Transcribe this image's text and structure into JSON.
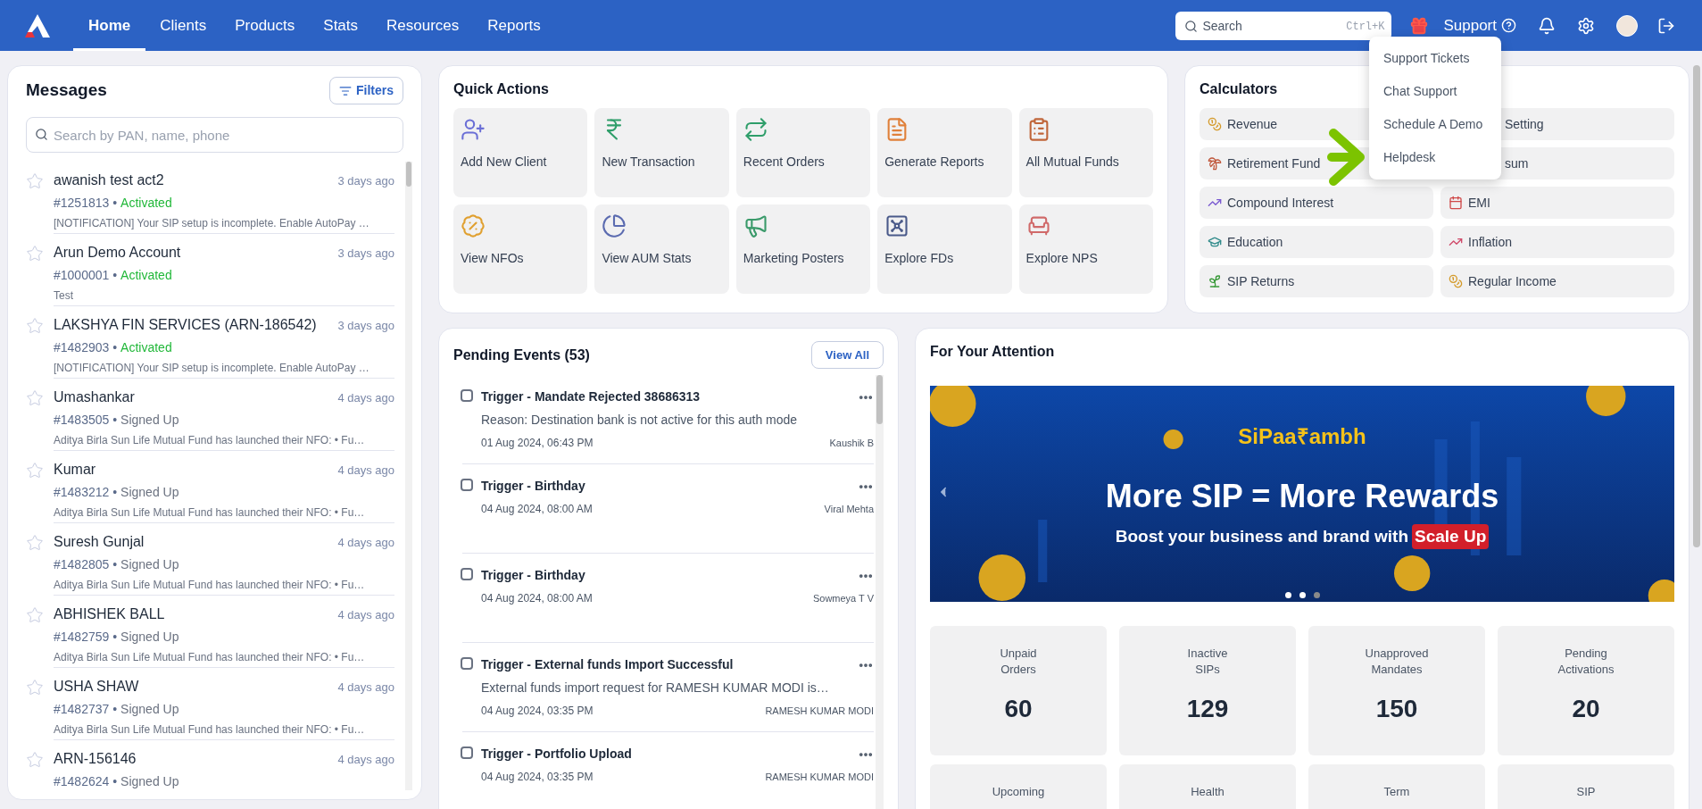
{
  "nav": {
    "tabs": [
      {
        "label": "Home",
        "selected": true
      },
      {
        "label": "Clients",
        "selected": false
      },
      {
        "label": "Products",
        "selected": false
      },
      {
        "label": "Stats",
        "selected": false
      },
      {
        "label": "Resources",
        "selected": false
      },
      {
        "label": "Reports",
        "selected": false
      }
    ],
    "search": {
      "placeholder": "Search",
      "shortcut": "Ctrl+K"
    },
    "support": "Support"
  },
  "support_menu": [
    "Support Tickets",
    "Chat Support",
    "Schedule A Demo",
    "Helpdesk"
  ],
  "messages": {
    "title": "Messages",
    "filters": "Filters",
    "search_placeholder": "Search by PAN, name, phone",
    "items": [
      {
        "name": "awanish test act2",
        "time": "3 days ago",
        "id": "#1251813 •",
        "status": "Activated",
        "kind": "activated",
        "starred": false,
        "preview": "[NOTIFICATION] Your SIP setup is incomplete. Enable AutoPay …"
      },
      {
        "name": "Arun Demo Account",
        "time": "3 days ago",
        "id": "#1000001 •",
        "status": "Activated",
        "kind": "activated",
        "starred": false,
        "preview": "Test"
      },
      {
        "name": "LAKSHYA FIN SERVICES (ARN-186542)",
        "time": "3 days ago",
        "id": "#1482903 •",
        "status": "Activated",
        "kind": "activated",
        "starred": false,
        "preview": "[NOTIFICATION] Your SIP setup is incomplete. Enable AutoPay …"
      },
      {
        "name": "Umashankar",
        "time": "4 days ago",
        "id": "#1483505 •",
        "status": "Signed Up",
        "kind": "signed",
        "starred": false,
        "preview": "Aditya Birla Sun Life Mutual Fund has launched their NFO: • Fu…"
      },
      {
        "name": "Kumar",
        "time": "4 days ago",
        "id": "#1483212 •",
        "status": "Signed Up",
        "kind": "signed",
        "starred": false,
        "preview": "Aditya Birla Sun Life Mutual Fund has launched their NFO: • Fu…"
      },
      {
        "name": "Suresh Gunjal",
        "time": "4 days ago",
        "id": "#1482805 •",
        "status": "Signed Up",
        "kind": "signed",
        "starred": false,
        "preview": "Aditya Birla Sun Life Mutual Fund has launched their NFO: • Fu…"
      },
      {
        "name": "ABHISHEK BALL",
        "time": "4 days ago",
        "id": "#1482759 •",
        "status": "Signed Up",
        "kind": "signed",
        "starred": false,
        "preview": "Aditya Birla Sun Life Mutual Fund has launched their NFO: • Fu…"
      },
      {
        "name": "USHA SHAW",
        "time": "4 days ago",
        "id": "#1482737 •",
        "status": "Signed Up",
        "kind": "signed",
        "starred": false,
        "preview": "Aditya Birla Sun Life Mutual Fund has launched their NFO: • Fu…"
      },
      {
        "name": "ARN-156146",
        "time": "4 days ago",
        "id": "#1482624 •",
        "status": "Signed Up",
        "kind": "signed",
        "starred": false
      }
    ]
  },
  "quick_actions": {
    "title": "Quick Actions",
    "items": [
      "Add New Client",
      "New Transaction",
      "Recent Orders",
      "Generate Reports",
      "All Mutual Funds",
      "View NFOs",
      "View AUM Stats",
      "Marketing Posters",
      "Explore FDs",
      "Explore NPS"
    ]
  },
  "calculators": {
    "title": "Calculators",
    "items": [
      {
        "label": "Revenue",
        "kind": "full"
      },
      {
        "label": "Setting",
        "kind": "covered"
      },
      {
        "label": "Retirement Fund",
        "kind": "full"
      },
      {
        "label": "sum",
        "kind": "covered"
      },
      {
        "label": "Compound Interest",
        "kind": "full"
      },
      {
        "label": "EMI",
        "kind": "full"
      },
      {
        "label": "Education",
        "kind": "full"
      },
      {
        "label": "Inflation",
        "kind": "full"
      },
      {
        "label": "SIP Returns",
        "kind": "full"
      },
      {
        "label": "Regular Income",
        "kind": "full"
      }
    ]
  },
  "pending_events": {
    "title": "Pending Events (53)",
    "view_all": "View All",
    "events": [
      {
        "title": "Trigger - Mandate Rejected 38686313",
        "detail": "Reason: Destination bank is not active for this auth mode",
        "time": "01 Aug 2024, 06:43 PM",
        "person": "Kaushik B",
        "checked": false
      },
      {
        "title": "Trigger - Birthday",
        "time": "04 Aug 2024, 08:00 AM",
        "person": "Viral Mehta",
        "checked": false
      },
      {
        "title": "Trigger - Birthday",
        "time": "04 Aug 2024, 08:00 AM",
        "person": "Sowmeya T V",
        "checked": false
      },
      {
        "title": "Trigger - External funds Import Successful",
        "detail": "External funds import request for RAMESH KUMAR MODI is…",
        "time": "04 Aug 2024, 03:35 PM",
        "person": "RAMESH KUMAR MODI",
        "checked": false
      },
      {
        "title": "Trigger - Portfolio Upload",
        "time": "04 Aug 2024, 03:35 PM",
        "person": "RAMESH KUMAR MODI",
        "checked": false
      }
    ]
  },
  "attention": {
    "title": "For Your Attention",
    "banner": {
      "brand": "SiPaa₹ambh",
      "headline": "More SIP = More Rewards",
      "tagline": "Boost your business and brand with",
      "highlight": "Scale Up",
      "dots": [
        {
          "selected": false
        },
        {
          "selected": false
        },
        {
          "selected": true
        }
      ]
    },
    "stats": [
      {
        "label": "Unpaid Orders",
        "value": "60"
      },
      {
        "label": "Inactive SIPs",
        "value": "129"
      },
      {
        "label": "Unapproved Mandates",
        "value": "150"
      },
      {
        "label": "Pending Activations",
        "value": "20"
      },
      {
        "label": "Upcoming"
      },
      {
        "label": "Health"
      },
      {
        "label": "Term"
      },
      {
        "label": "SIP"
      }
    ]
  }
}
